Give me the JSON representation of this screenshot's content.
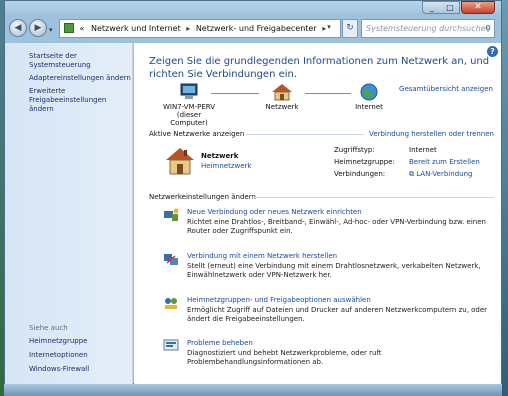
{
  "window": {
    "controls": [
      "_",
      "□"
    ],
    "close_label": "✕"
  },
  "addressbar": {
    "back_icon": "back-arrow-icon",
    "forward_icon": "forward-arrow-icon",
    "chevron": "«",
    "crumbs": [
      "Netzwerk und Internet",
      "Netzwerk- und Freigabecenter"
    ],
    "separator": "▸",
    "dropdown": "▾",
    "refresh": "↻",
    "search_placeholder": "Systemsteuerung durchsuchen",
    "search_icon": "search-icon"
  },
  "sidebar": {
    "home": "Startseite der Systemsteuerung",
    "items": [
      "Adaptereinstellungen ändern",
      "Erweiterte Freigabeeinstellungen ändern"
    ],
    "see_also_title": "Siehe auch",
    "see_also": [
      "Heimnetzgruppe",
      "Internetoptionen",
      "Windows-Firewall"
    ]
  },
  "main": {
    "help": "?",
    "title": "Zeigen Sie die grundlegenden Informationen zum Netzwerk an, und richten Sie Verbindungen ein.",
    "overview_link": "Gesamtübersicht anzeigen",
    "map": {
      "computer": "WIN7-VM-PERV",
      "computer_sub": "(dieser Computer)",
      "network": "Netzwerk",
      "internet": "Internet"
    },
    "active_header": "Aktive Netzwerke anzeigen",
    "connect_link": "Verbindung herstellen oder trennen",
    "active_network": {
      "name": "Netzwerk",
      "type": "Heimnetzwerk",
      "access_label": "Zugriffstyp:",
      "access_value": "Internet",
      "homegroup_label": "Heimnetzgruppe:",
      "homegroup_value": "Bereit zum Erstellen",
      "connections_label": "Verbindungen:",
      "connections_value": "LAN-Verbindung"
    },
    "settings_header": "Netzwerkeinstellungen ändern",
    "tasks": [
      {
        "title": "Neue Verbindung oder neues Netzwerk einrichten",
        "desc": "Richtet eine Drahtlos-, Breitband-, Einwähl-, Ad-hoc- oder VPN-Verbindung bzw. einen Router oder Zugriffspunkt ein."
      },
      {
        "title": "Verbindung mit einem Netzwerk herstellen",
        "desc": "Stellt (erneut) eine Verbindung mit einem Drahtlosnetzwerk, verkabelten Netzwerk, Einwählnetzwerk oder VPN-Netzwerk her."
      },
      {
        "title": "Heimnetzgruppen- und Freigabeoptionen auswählen",
        "desc": "Ermöglicht Zugriff auf Dateien und Drucker auf anderen Netzwerkcomputern zu, oder ändert die Freigabeeinstellungen."
      },
      {
        "title": "Probleme beheben",
        "desc": "Diagnostiziert und behebt Netzwerkprobleme, oder ruft Problembehandlungsinformationen ab."
      }
    ]
  }
}
